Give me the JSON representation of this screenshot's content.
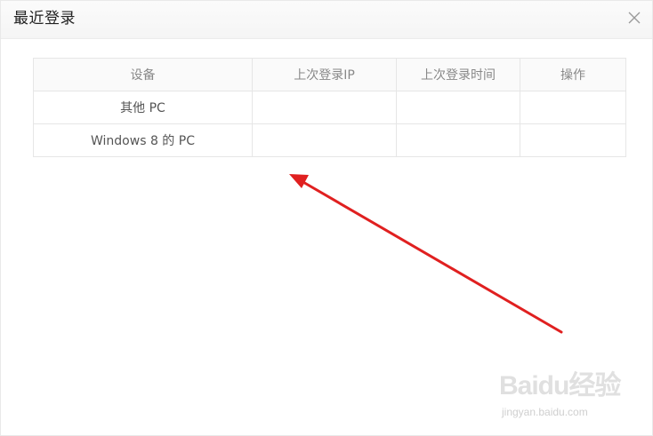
{
  "dialog": {
    "title": "最近登录",
    "close_icon": "close-icon"
  },
  "table": {
    "headers": [
      "设备",
      "上次登录IP",
      "上次登录时间",
      "操作"
    ],
    "rows": [
      [
        "其他 PC",
        "",
        "",
        ""
      ],
      [
        "Windows 8 的 PC",
        "",
        "",
        ""
      ]
    ]
  },
  "annotation": {
    "arrow_color": "#e02020"
  },
  "watermark": {
    "brand": "Baidu经验",
    "url": "jingyan.baidu.com"
  }
}
